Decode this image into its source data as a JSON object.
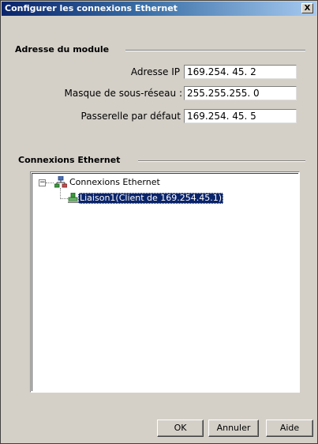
{
  "window": {
    "title": "Configurer les connexions Ethernet",
    "close_label": "X"
  },
  "module": {
    "section_title": "Adresse du module",
    "ip_label": "Adresse IP",
    "ip_value": "169.254. 45. 2",
    "mask_label": "Masque de sous-réseau :",
    "mask_value": "255.255.255. 0",
    "gateway_label": "Passerelle par défaut",
    "gateway_value": "169.254. 45. 5"
  },
  "connections": {
    "section_title": "Connexions Ethernet",
    "tree": {
      "root_expander": "−",
      "root_label": "Connexions Ethernet",
      "child_label": "Liaison1(Client de  169.254.45.1)",
      "root_icon": "network-icon",
      "child_icon": "plug-icon"
    }
  },
  "buttons": {
    "ok": "OK",
    "cancel": "Annuler",
    "help": "Aide"
  },
  "colors": {
    "title_bar": "#0a246a",
    "selection": "#0a246a",
    "dialog_bg": "#d4d0c8",
    "icon_green": "#3a9a3a"
  }
}
